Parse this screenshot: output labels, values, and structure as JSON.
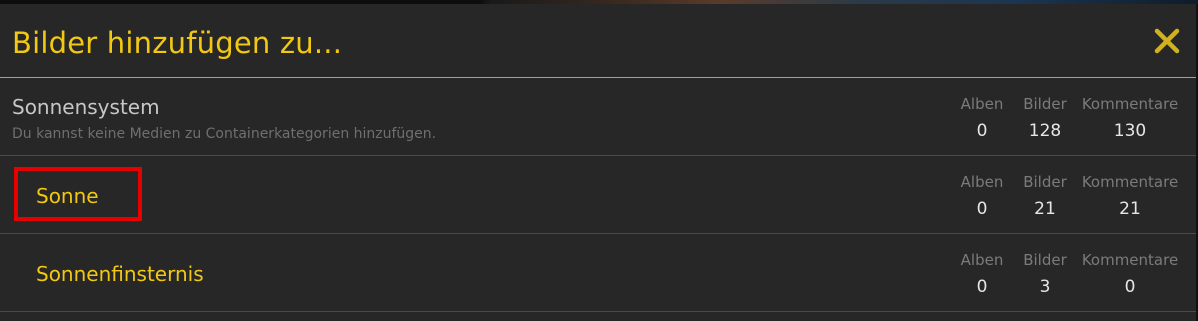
{
  "dialog": {
    "title": "Bilder hinzufügen zu...",
    "close_icon": "close-icon"
  },
  "colors": {
    "accent": "#f2c811",
    "background": "#272727",
    "highlight": "#e60000"
  },
  "stat_labels": {
    "alben": "Alben",
    "bilder": "Bilder",
    "kommentare": "Kommentare"
  },
  "categories": [
    {
      "name": "Sonnensystem",
      "description": "Du kannst keine Medien zu Containerkategorien hinzufügen.",
      "alben": "0",
      "bilder": "128",
      "kommentare": "130"
    },
    {
      "name": "Sonne",
      "alben": "0",
      "bilder": "21",
      "kommentare": "21"
    },
    {
      "name": "Sonnenfinsternis",
      "alben": "0",
      "bilder": "3",
      "kommentare": "0"
    }
  ]
}
